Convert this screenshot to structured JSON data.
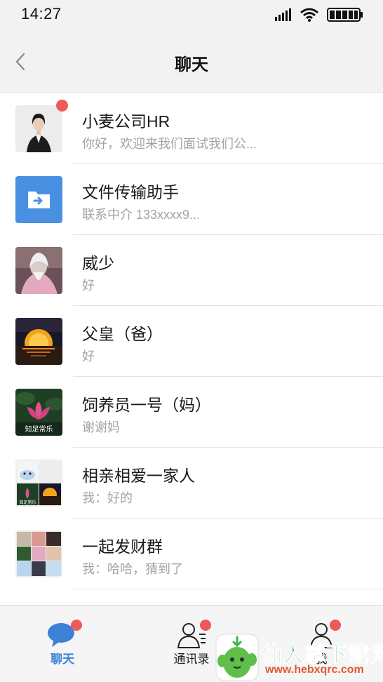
{
  "status_bar": {
    "time": "14:27"
  },
  "nav": {
    "title": "聊天"
  },
  "chats": [
    {
      "name": "小麦公司HR",
      "preview": "你好，欢迎来我们面试我们公...",
      "unread": true,
      "avatar": "woman-in-suit-photo"
    },
    {
      "name": "文件传输助手",
      "preview": "联系中介 133xxxx9...",
      "unread": false,
      "avatar": "file-transfer-icon"
    },
    {
      "name": "威少",
      "preview": "好",
      "unread": false,
      "avatar": "wizard-photo"
    },
    {
      "name": "父皇（爸）",
      "preview": "好",
      "unread": false,
      "avatar": "sunset-photo"
    },
    {
      "name": "饲养员一号（妈）",
      "preview": "谢谢妈",
      "unread": false,
      "avatar": "lotus-photo",
      "avatar_caption": "知足常乐"
    },
    {
      "name": "相亲相爱一家人",
      "preview": "我：好的",
      "unread": false,
      "avatar": "group-grid-avatar",
      "avatar_caption": "知足常乐"
    },
    {
      "name": "一起发财群",
      "preview": "我：哈哈，猜到了",
      "unread": false,
      "avatar": "group-grid-avatar"
    }
  ],
  "tabs": [
    {
      "label": "聊天",
      "icon": "chat-bubble-icon",
      "active": true,
      "badge": true
    },
    {
      "label": "通讯录",
      "icon": "contacts-icon",
      "active": false,
      "badge": true
    },
    {
      "label": "我",
      "icon": "me-icon",
      "active": false,
      "badge": true
    }
  ],
  "watermark": {
    "text": "仙人掌下载网",
    "url": "www.hebxqrc.com"
  },
  "colors": {
    "accent": "#3b82d6",
    "badge": "#ee5a5a",
    "file_helper": "#4a90e2",
    "watermark_green": "#37b44a"
  }
}
